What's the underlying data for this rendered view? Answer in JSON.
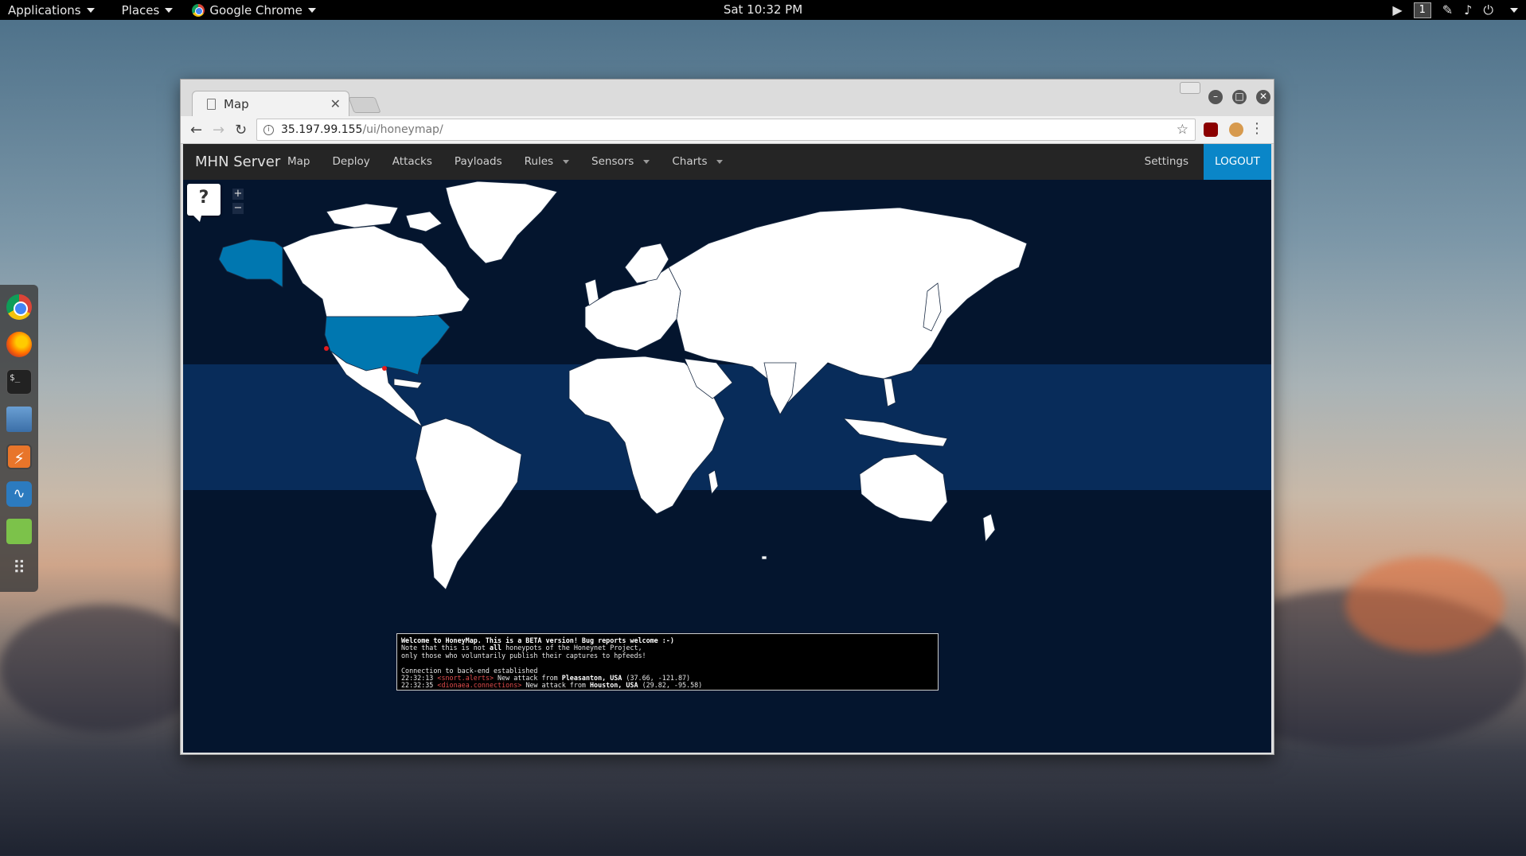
{
  "topbar": {
    "applications": "Applications",
    "places": "Places",
    "active_app": "Google Chrome",
    "clock": "Sat 10:32 PM",
    "workspace": "1"
  },
  "dock": {
    "items": [
      "chrome-icon",
      "firefox-icon",
      "terminal-icon",
      "files-icon",
      "burpsuite-icon",
      "wireshark-icon",
      "notes-icon",
      "app-grid-icon"
    ]
  },
  "browser": {
    "tab_title": "Map",
    "url_host": "35.197.99.155",
    "url_path": "/ui/honeymap/"
  },
  "app": {
    "brand": "MHN Server",
    "nav": [
      {
        "label": "Map",
        "dropdown": false
      },
      {
        "label": "Deploy",
        "dropdown": false
      },
      {
        "label": "Attacks",
        "dropdown": false
      },
      {
        "label": "Payloads",
        "dropdown": false
      },
      {
        "label": "Rules",
        "dropdown": true
      },
      {
        "label": "Sensors",
        "dropdown": true
      },
      {
        "label": "Charts",
        "dropdown": true
      }
    ],
    "settings": "Settings",
    "logout": "LOGOUT",
    "accent": "#0a86c8"
  },
  "map": {
    "help": "?",
    "zoom_in": "+",
    "zoom_out": "−",
    "highlight_color": "#0077b0",
    "attack_marker_color": "#e41a1c",
    "highlighted_countries": [
      "USA"
    ]
  },
  "console": {
    "welcome": "Welcome to HoneyMap. This is a BETA version! Bug reports welcome :-)",
    "note_pre": "Note that this is not ",
    "note_bold": "all",
    "note_post": " honeypots of the Honeynet Project,",
    "note2": "only those who voluntarily publish their captures to hpfeeds!",
    "connection": "Connection to back-end established",
    "events": [
      {
        "time": "22:32:13",
        "channel": "snort.alerts",
        "msg": " New attack from ",
        "place": "Pleasanton, USA",
        "coords": " (37.66, -121.87)"
      },
      {
        "time": "22:32:35",
        "channel": "dionaea.connections",
        "msg": " New attack from ",
        "place": "Houston, USA",
        "coords": " (29.82, -95.58)"
      }
    ]
  }
}
